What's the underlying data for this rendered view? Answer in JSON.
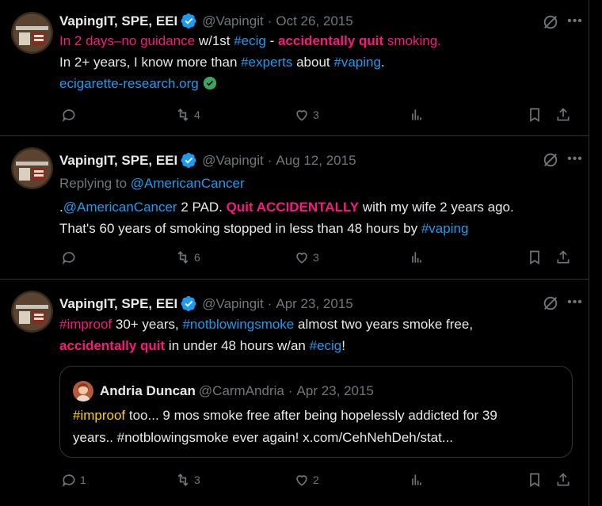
{
  "tweets": [
    {
      "name": "VapingIT, SPE, EEI",
      "handle": "@Vapingit",
      "date": "Oct 26, 2015",
      "line1": [
        "In 2 days–no guidance",
        " w/1st ",
        "#ecig",
        " - ",
        "accidentally quit",
        " smoking."
      ],
      "line2": [
        "In 2+ years, I know more than ",
        "#experts",
        " about ",
        "#vaping",
        "."
      ],
      "link": "ecigarette-research.org",
      "replies": "",
      "reposts": "4",
      "likes": "3"
    },
    {
      "name": "VapingIT, SPE, EEI",
      "handle": "@Vapingit",
      "date": "Aug 12, 2015",
      "replying_prefix": "Replying to ",
      "replying_to": "@AmericanCancer",
      "line1": [
        ".",
        "@AmericanCancer",
        " 2 PAD. ",
        "Quit ACCIDENTALLY",
        " with my wife 2 years ago."
      ],
      "line2": [
        "That's 60 years of smoking stopped in less than 48 hours by ",
        "#vaping"
      ],
      "replies": "",
      "reposts": "6",
      "likes": "3"
    },
    {
      "name": "VapingIT, SPE, EEI",
      "handle": "@Vapingit",
      "date": "Apr 23, 2015",
      "line1": [
        "#improof",
        " 30+ years, ",
        "#notblowingsmoke",
        " almost two years smoke free,"
      ],
      "line2": [
        "accidentally quit",
        " in under 48 hours w/an ",
        "#ecig",
        "!"
      ],
      "replies": "1",
      "reposts": "3",
      "likes": "2",
      "quote": {
        "name": "Andria Duncan",
        "handle": "@CarmAndria",
        "date": "Apr 23, 2015",
        "line1": [
          "#improof",
          " too... 9 mos smoke free after being hopelessly addicted for 39"
        ],
        "line2": "years.. #notblowingsmoke ever again! x.com/CehNehDeh/stat..."
      }
    }
  ],
  "dot": "·",
  "more_glyph": "•••",
  "icons": [
    "verified-badge-icon",
    "grok-icon",
    "more-icon",
    "reply-icon",
    "repost-icon",
    "like-icon",
    "views-icon",
    "bookmark-icon",
    "share-icon",
    "verified-link-icon"
  ],
  "colors": {
    "background": "#000000",
    "text": "#e7e9ea",
    "muted": "#71767b",
    "link": "#1d9bf0",
    "highlight": "#f91880",
    "hashtag_yellow": "#ffd400",
    "border": "#2f3336"
  }
}
